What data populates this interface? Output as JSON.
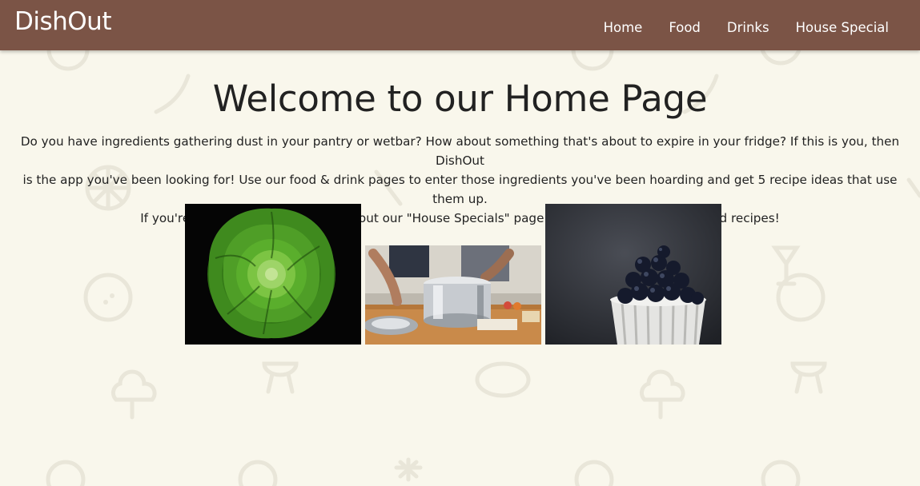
{
  "navbar": {
    "brand": "DishOut",
    "links": [
      {
        "label": "Home"
      },
      {
        "label": "Food"
      },
      {
        "label": "Drinks"
      },
      {
        "label": "House Special"
      }
    ],
    "background_color": "#7b5446"
  },
  "main": {
    "title": "Welcome to our Home Page",
    "intro_lines": [
      "Do you have ingredients gathering dust in your pantry or wetbar? How about something that's about to expire in your fridge? If this is you, then DishOut",
      "is the app you've been looking for! Use our food & drink pages to enter those ingredients you've been hoarding and get 5 recipe ideas that use them up.",
      "If you're feeling adventurous check out our \"House Specials\" page to get random drink and food recipes!"
    ],
    "images": [
      {
        "subject": "lettuce-photo"
      },
      {
        "subject": "cooking-pot-photo"
      },
      {
        "subject": "blueberries-photo"
      }
    ]
  },
  "page_background_color": "#f9f7ec"
}
